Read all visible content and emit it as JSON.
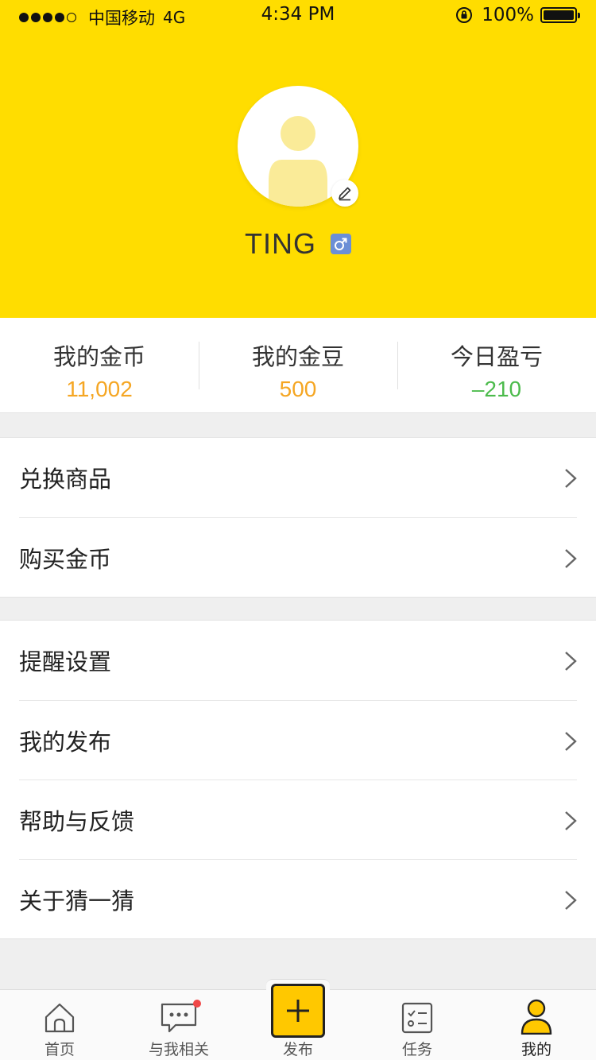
{
  "status_bar": {
    "carrier": "中国移动",
    "network": "4G",
    "time": "4:34 PM",
    "battery": "100%"
  },
  "profile": {
    "username": "TING",
    "gender_icon": "male-icon",
    "avatar_icon": "default-avatar-icon",
    "edit_icon": "pencil-icon"
  },
  "stats": [
    {
      "label": "我的金币",
      "value": "11,002",
      "color": "#f5a623"
    },
    {
      "label": "我的金豆",
      "value": "500",
      "color": "#f5a623"
    },
    {
      "label": "今日盈亏",
      "value": "–210",
      "color": "#4cbb4c"
    }
  ],
  "menu_group_1": [
    {
      "label": "兑换商品"
    },
    {
      "label": "购买金币"
    }
  ],
  "menu_group_2": [
    {
      "label": "提醒设置"
    },
    {
      "label": "我的发布"
    },
    {
      "label": "帮助与反馈"
    },
    {
      "label": "关于猜一猜"
    }
  ],
  "tabbar": [
    {
      "label": "首页",
      "icon": "home-icon"
    },
    {
      "label": "与我相关",
      "icon": "message-icon"
    },
    {
      "label": "发布",
      "icon": "plus-icon"
    },
    {
      "label": "任务",
      "icon": "task-list-icon"
    },
    {
      "label": "我的",
      "icon": "user-icon"
    }
  ],
  "colors": {
    "brand_yellow": "#ffdd00",
    "coin_orange": "#f5a623",
    "profit_green": "#4cbb4c",
    "gender_blue": "#6b8fd6",
    "notify_red": "#f04848"
  }
}
